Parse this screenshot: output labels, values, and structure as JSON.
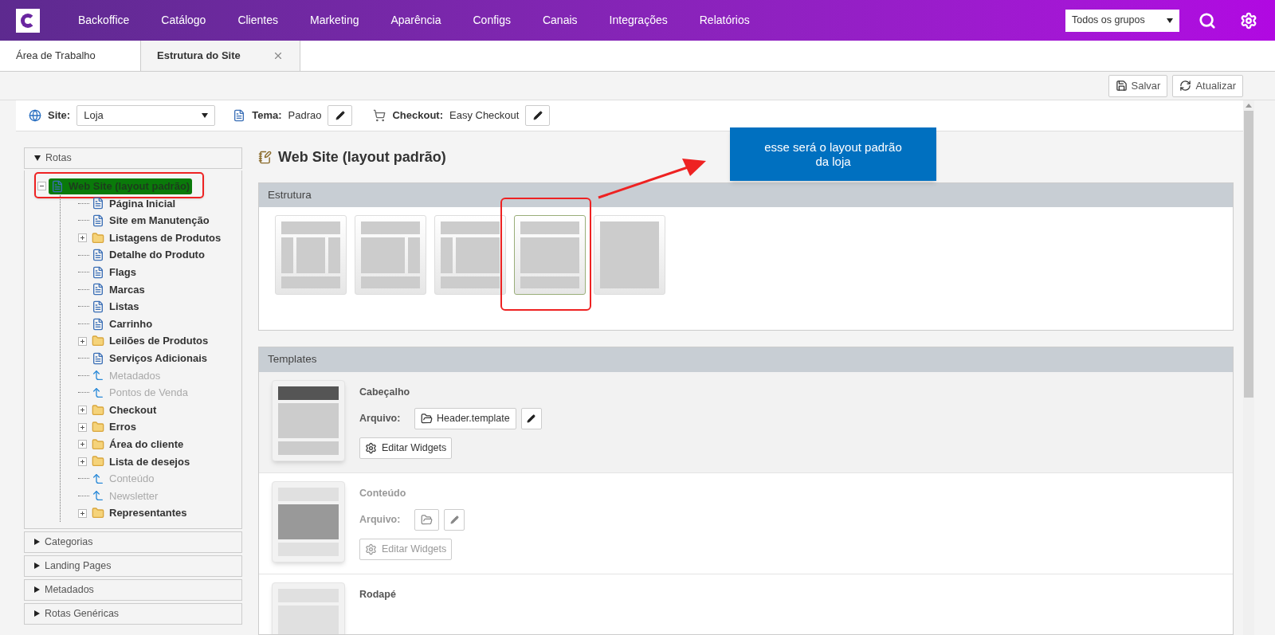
{
  "nav": {
    "items": [
      {
        "label": "Backoffice"
      },
      {
        "label": "Catálogo"
      },
      {
        "label": "Clientes"
      },
      {
        "label": "Marketing"
      },
      {
        "label": "Aparência"
      },
      {
        "label": "Configs"
      },
      {
        "label": "Canais"
      },
      {
        "label": "Integrações"
      },
      {
        "label": "Relatórios"
      }
    ],
    "group_select": "Todos os grupos"
  },
  "tabs": [
    {
      "label": "Área de Trabalho",
      "selected": false,
      "closable": false
    },
    {
      "label": "Estrutura do Site",
      "selected": true,
      "closable": true
    }
  ],
  "toolbar": {
    "buttons": [
      {
        "label": "Salvar",
        "kind": "save"
      },
      {
        "label": "Atualizar",
        "kind": "refresh"
      }
    ]
  },
  "site_bar": {
    "site_label": "Site:",
    "site_value": "Loja",
    "theme_label": "Tema:",
    "theme_value": "Padrao",
    "checkout_label": "Checkout:",
    "checkout_value": "Easy Checkout"
  },
  "sidebar": {
    "sections": [
      {
        "label": "Rotas",
        "expanded": true,
        "tree": [
          {
            "label": "Web Site (layout padrão)",
            "kind": "page",
            "selected": true,
            "annotated": true,
            "expanded": true,
            "children": [
              {
                "label": "Página Inicial",
                "kind": "page",
                "selected": false
              },
              {
                "label": "Site em Manutenção",
                "kind": "page",
                "selected": false
              },
              {
                "label": "Listagens de Produtos",
                "kind": "folder",
                "selected": false,
                "expanded": false
              },
              {
                "label": "Detalhe do Produto",
                "kind": "page",
                "selected": false
              },
              {
                "label": "Flags",
                "kind": "page",
                "selected": false
              },
              {
                "label": "Marcas",
                "kind": "page",
                "selected": false
              },
              {
                "label": "Listas",
                "kind": "page",
                "selected": false
              },
              {
                "label": "Carrinho",
                "kind": "page",
                "selected": false
              },
              {
                "label": "Leilões de Produtos",
                "kind": "folder",
                "selected": false,
                "expanded": false
              },
              {
                "label": "Serviços Adicionais",
                "kind": "page",
                "selected": false
              },
              {
                "label": "Metadados",
                "kind": "link",
                "selected": false
              },
              {
                "label": "Pontos de Venda",
                "kind": "link",
                "selected": false
              },
              {
                "label": "Checkout",
                "kind": "folder",
                "selected": false,
                "expanded": false
              },
              {
                "label": "Erros",
                "kind": "folder",
                "selected": false,
                "expanded": false
              },
              {
                "label": "Área do cliente",
                "kind": "folder",
                "selected": false,
                "expanded": false
              },
              {
                "label": "Lista de desejos",
                "kind": "folder",
                "selected": false,
                "expanded": false
              },
              {
                "label": "Conteúdo",
                "kind": "link",
                "selected": false
              },
              {
                "label": "Newsletter",
                "kind": "link",
                "selected": false
              },
              {
                "label": "Representantes",
                "kind": "folder",
                "selected": false,
                "expanded": false
              }
            ]
          }
        ]
      },
      {
        "label": "Categorias",
        "expanded": false
      },
      {
        "label": "Landing Pages",
        "expanded": false
      },
      {
        "label": "Metadados",
        "expanded": false
      },
      {
        "label": "Rotas Genéricas",
        "expanded": false
      }
    ]
  },
  "main": {
    "title": "Web Site (layout padrão)",
    "structure": {
      "title": "Estrutura",
      "layouts": [
        {
          "kind": "three-column",
          "selected": false
        },
        {
          "kind": "right-sidebar",
          "selected": false
        },
        {
          "kind": "left-sidebar",
          "selected": false
        },
        {
          "kind": "single-column",
          "selected": true,
          "annotated": true
        },
        {
          "kind": "full",
          "selected": false
        }
      ]
    },
    "callout": "esse será o layout padrão da loja",
    "templates": {
      "title": "Templates",
      "items": [
        {
          "title": "Cabeçalho",
          "kind": "header",
          "selected": true,
          "disabled": false,
          "file_label": "Arquivo:",
          "file": "Header.template",
          "widgets": "Editar Widgets"
        },
        {
          "title": "Conteúdo",
          "kind": "content",
          "selected": false,
          "disabled": true,
          "file_label": "Arquivo:",
          "widgets": "Editar Widgets"
        },
        {
          "title": "Rodapé",
          "kind": "footer",
          "selected": false,
          "disabled": false
        }
      ]
    }
  }
}
